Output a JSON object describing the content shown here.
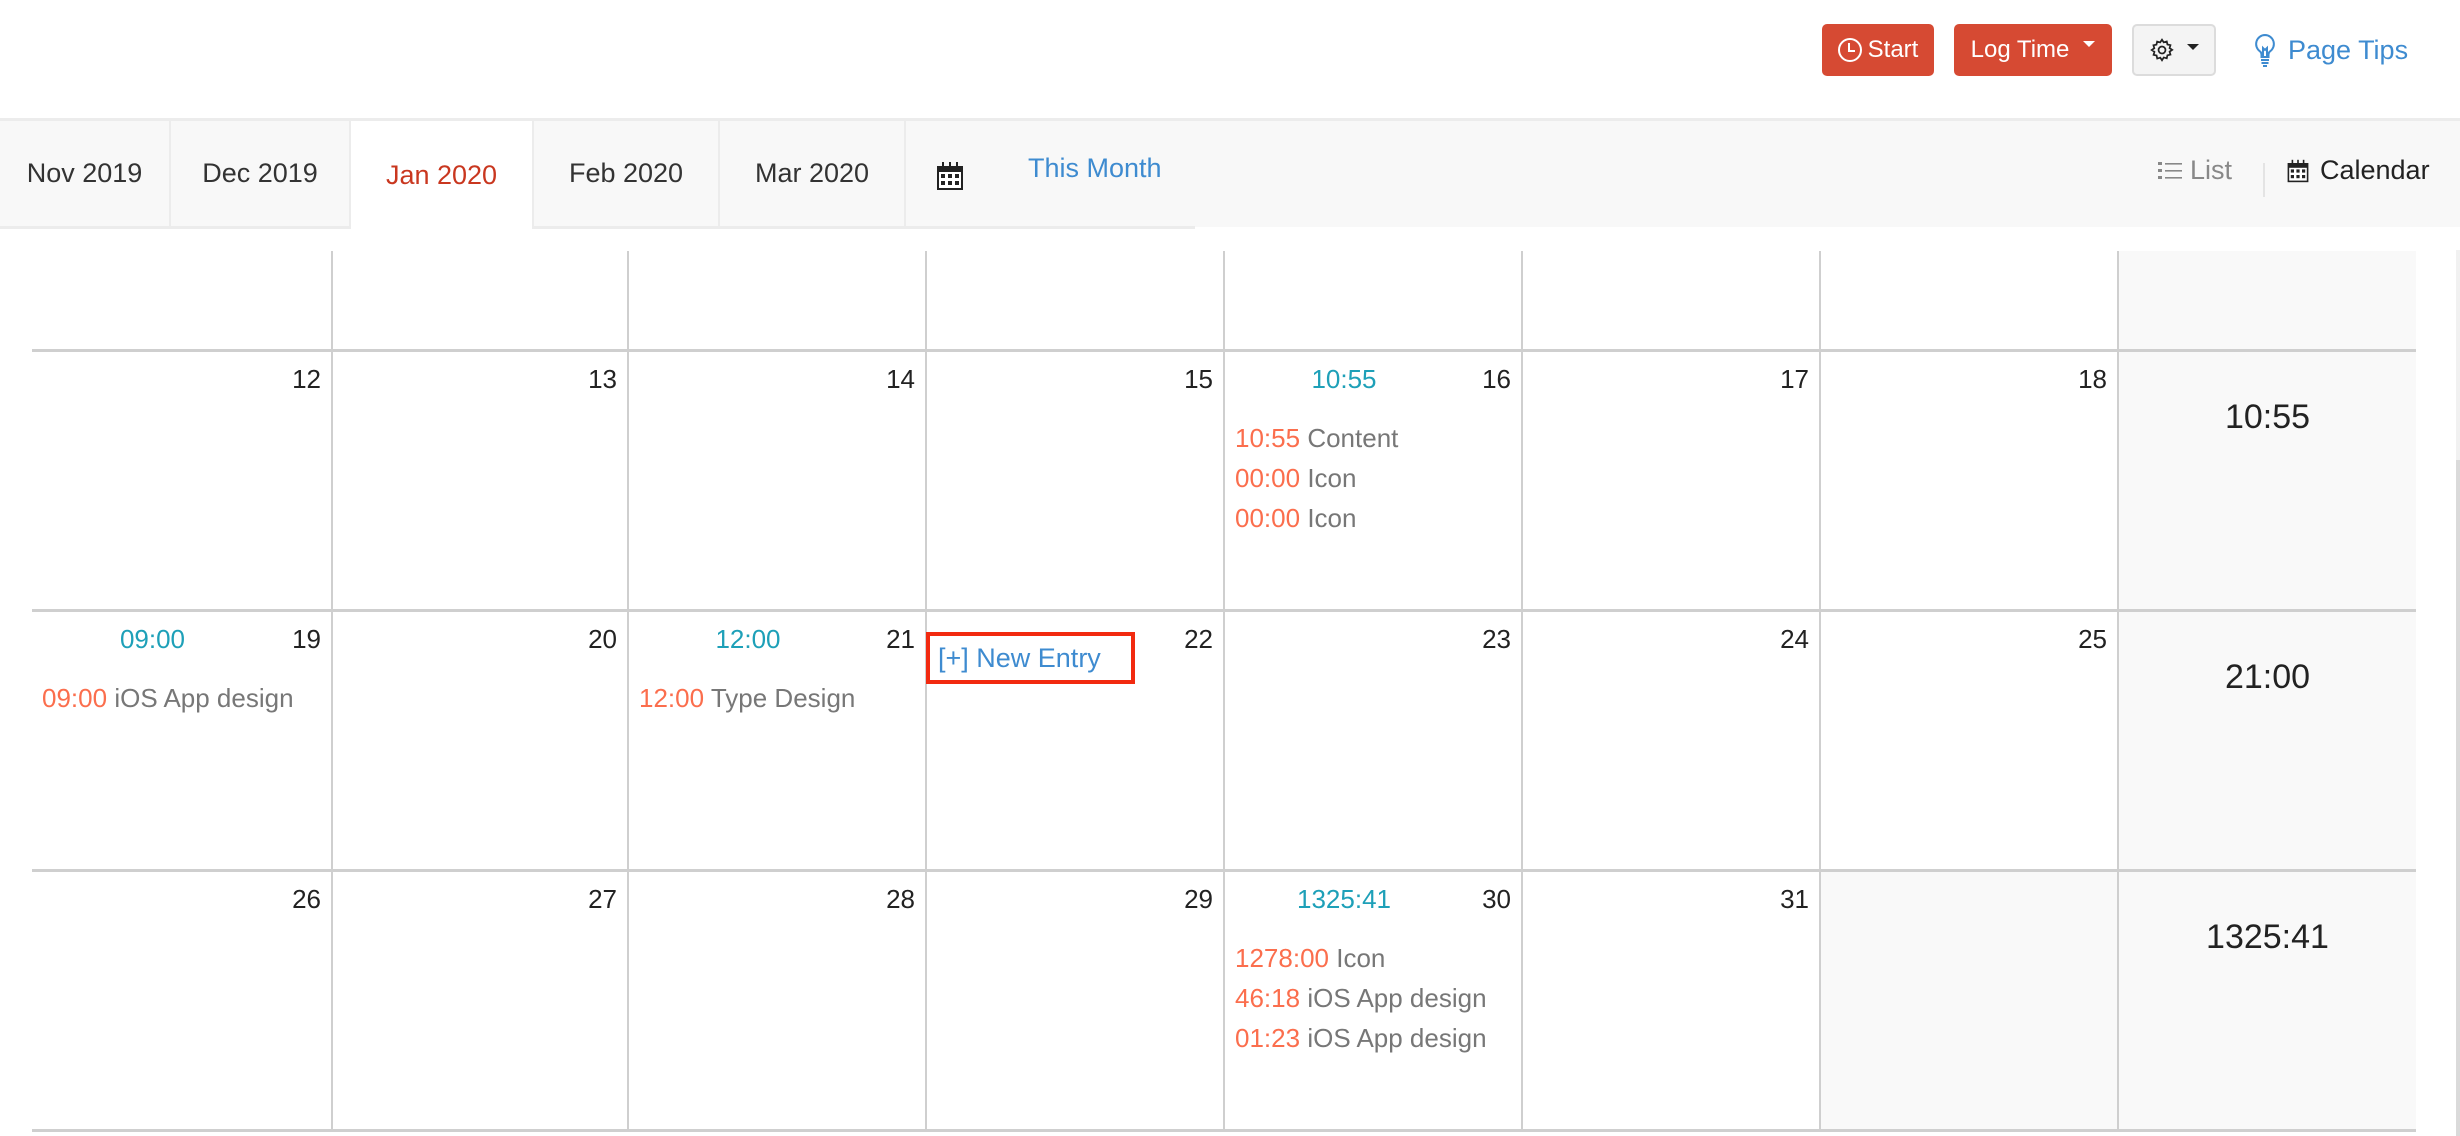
{
  "header": {
    "start_label": "Start",
    "log_time_label": "Log Time",
    "page_tips_label": "Page Tips",
    "icons": {
      "start": "clock-icon",
      "settings": "gear-icon",
      "tips": "lightbulb-icon"
    }
  },
  "tabs": [
    {
      "label": "Nov 2019",
      "active": false
    },
    {
      "label": "Dec 2019",
      "active": false
    },
    {
      "label": "Jan 2020",
      "active": true
    },
    {
      "label": "Feb 2020",
      "active": false
    },
    {
      "label": "Mar 2020",
      "active": false
    }
  ],
  "this_month_label": "This Month",
  "views": {
    "list_label": "List",
    "calendar_label": "Calendar",
    "active": "Calendar"
  },
  "colors": {
    "accent_red": "#d64a33",
    "active_tab": "#c9371f",
    "link_blue": "#3e8bd0",
    "day_total": "#1ea0b8",
    "entry_time": "#fb6e4d",
    "highlight_box": "#f22a10"
  },
  "calendar": {
    "weeks": [
      {
        "days": [
          {
            "day": ""
          },
          {
            "day": ""
          },
          {
            "day": ""
          },
          {
            "day": ""
          },
          {
            "day": ""
          },
          {
            "day": ""
          },
          {
            "day": ""
          }
        ],
        "week_total": ""
      },
      {
        "days": [
          {
            "day": "12"
          },
          {
            "day": "13"
          },
          {
            "day": "14"
          },
          {
            "day": "15"
          },
          {
            "day": "16",
            "total": "10:55",
            "entries": [
              {
                "time": "10:55",
                "name": "Content"
              },
              {
                "time": "00:00",
                "name": "Icon"
              },
              {
                "time": "00:00",
                "name": "Icon"
              }
            ]
          },
          {
            "day": "17"
          },
          {
            "day": "18"
          }
        ],
        "week_total": "10:55"
      },
      {
        "days": [
          {
            "day": "19",
            "total": "09:00",
            "entries": [
              {
                "time": "09:00",
                "name": "iOS App design"
              }
            ]
          },
          {
            "day": "20"
          },
          {
            "day": "21",
            "total": "12:00",
            "entries": [
              {
                "time": "12:00",
                "name": "Type Design"
              }
            ]
          },
          {
            "day": "22"
          },
          {
            "day": "23"
          },
          {
            "day": "24"
          },
          {
            "day": "25"
          }
        ],
        "week_total": "21:00"
      },
      {
        "days": [
          {
            "day": "26"
          },
          {
            "day": "27"
          },
          {
            "day": "28"
          },
          {
            "day": "29"
          },
          {
            "day": "30",
            "total": "1325:41",
            "entries": [
              {
                "time": "1278:00",
                "name": "Icon"
              },
              {
                "time": "46:18",
                "name": "iOS App design"
              },
              {
                "time": "01:23",
                "name": "iOS App design"
              }
            ]
          },
          {
            "day": "31"
          },
          {
            "day": "",
            "outside_month": true
          }
        ],
        "week_total": "1325:41"
      }
    ],
    "new_entry_label": "[+] New Entry"
  }
}
